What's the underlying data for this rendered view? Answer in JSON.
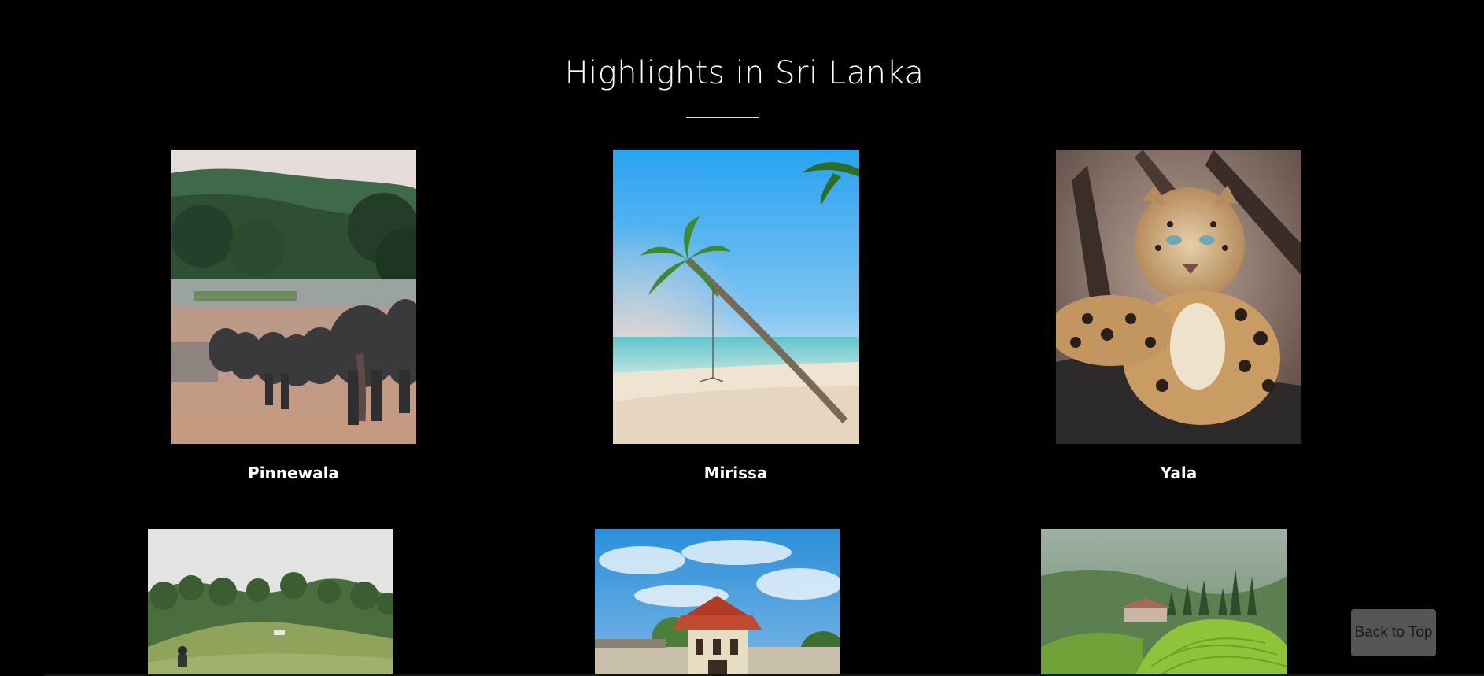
{
  "heading": {
    "title": "Highlights in Sri Lanka"
  },
  "highlights": [
    {
      "name": "Pinnewala",
      "image": "elephants-photo"
    },
    {
      "name": "Mirissa",
      "image": "palm-beach-photo"
    },
    {
      "name": "Yala",
      "image": "leopard-photo"
    },
    {
      "name": "",
      "image": "hillside-photo"
    },
    {
      "name": "",
      "image": "temple-photo"
    },
    {
      "name": "",
      "image": "tea-plantation-photo"
    }
  ],
  "back_to_top": {
    "label": "Back to Top"
  }
}
